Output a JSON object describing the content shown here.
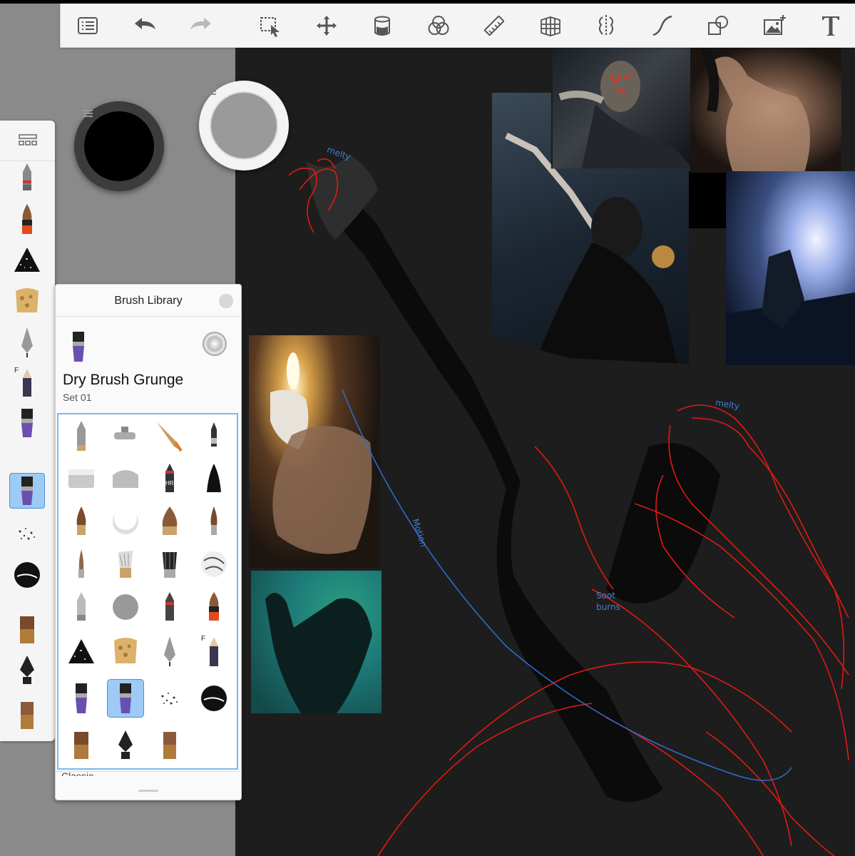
{
  "app": {
    "accent_color": "#4a90d9",
    "canvas_color": "#1d1d1d"
  },
  "toolbar": {
    "tools": [
      {
        "name": "menu-icon"
      },
      {
        "name": "undo-icon"
      },
      {
        "name": "redo-icon"
      },
      {
        "name": "selection-icon"
      },
      {
        "name": "transform-icon"
      },
      {
        "name": "fill-icon"
      },
      {
        "name": "color-harmony-icon"
      },
      {
        "name": "ruler-icon"
      },
      {
        "name": "perspective-icon"
      },
      {
        "name": "symmetry-icon"
      },
      {
        "name": "curve-icon"
      },
      {
        "name": "shapes-icon"
      },
      {
        "name": "add-image-icon"
      },
      {
        "name": "text-icon"
      }
    ]
  },
  "color_pucks": {
    "primary": "#000000",
    "secondary": "#9a9a9a"
  },
  "brush_library": {
    "title": "Brush Library",
    "brush_name": "Dry Brush Grunge",
    "set_name": "Set 01",
    "footer_peek": "Classic"
  },
  "canvas_notes": {
    "note_1": "melty",
    "note_2": "melty",
    "note_3": "Motion",
    "note_4": "Soot",
    "note_5": "burns"
  }
}
